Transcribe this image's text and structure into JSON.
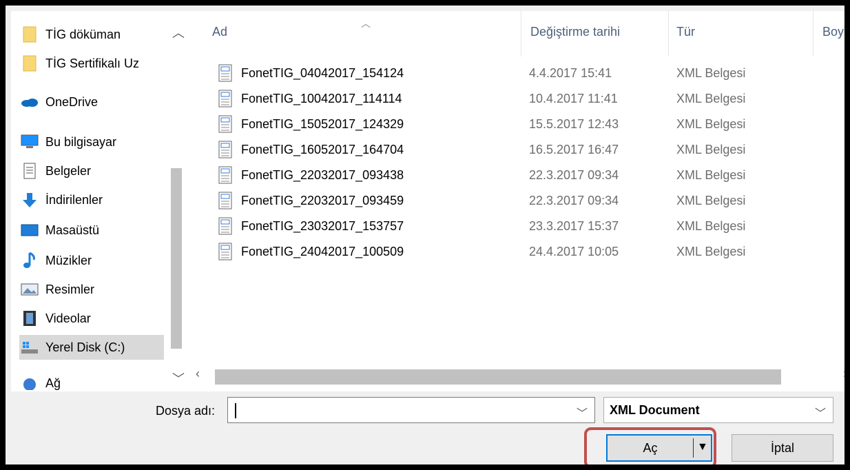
{
  "sidebar": {
    "items": [
      {
        "label": "TİG döküman",
        "icon": "folder-icon"
      },
      {
        "label": "TİG Sertifikalı Uz",
        "icon": "folder-icon"
      },
      {
        "label": "OneDrive",
        "icon": "cloud-icon"
      },
      {
        "label": "Bu bilgisayar",
        "icon": "computer-icon"
      },
      {
        "label": "Belgeler",
        "icon": "documents-icon"
      },
      {
        "label": "İndirilenler",
        "icon": "download-icon"
      },
      {
        "label": "Masaüstü",
        "icon": "desktop-icon"
      },
      {
        "label": "Müzikler",
        "icon": "music-icon"
      },
      {
        "label": "Resimler",
        "icon": "pictures-icon"
      },
      {
        "label": "Videolar",
        "icon": "videos-icon"
      },
      {
        "label": "Yerel Disk (C:)",
        "icon": "drive-icon"
      },
      {
        "label": "Ağ",
        "icon": "network-icon"
      }
    ]
  },
  "columns": {
    "name": "Ad",
    "date": "Değiştirme tarihi",
    "type": "Tür",
    "size": "Boy"
  },
  "files": [
    {
      "name": "FonetTIG_04042017_154124",
      "date": "4.4.2017 15:41",
      "type": "XML Belgesi"
    },
    {
      "name": "FonetTIG_10042017_114114",
      "date": "10.4.2017 11:41",
      "type": "XML Belgesi"
    },
    {
      "name": "FonetTIG_15052017_124329",
      "date": "15.5.2017 12:43",
      "type": "XML Belgesi"
    },
    {
      "name": "FonetTIG_16052017_164704",
      "date": "16.5.2017 16:47",
      "type": "XML Belgesi"
    },
    {
      "name": "FonetTIG_22032017_093438",
      "date": "22.3.2017 09:34",
      "type": "XML Belgesi"
    },
    {
      "name": "FonetTIG_22032017_093459",
      "date": "22.3.2017 09:34",
      "type": "XML Belgesi"
    },
    {
      "name": "FonetTIG_23032017_153757",
      "date": "23.3.2017 15:37",
      "type": "XML Belgesi"
    },
    {
      "name": "FonetTIG_24042017_100509",
      "date": "24.4.2017 10:05",
      "type": "XML Belgesi"
    }
  ],
  "bottom": {
    "filename_label": "Dosya adı:",
    "filename_value": "",
    "filetype_selected": "XML Document",
    "open_label": "Aç",
    "cancel_label": "İptal"
  },
  "colors": {
    "highlight": "#c0504d",
    "focus": "#0078d7"
  }
}
